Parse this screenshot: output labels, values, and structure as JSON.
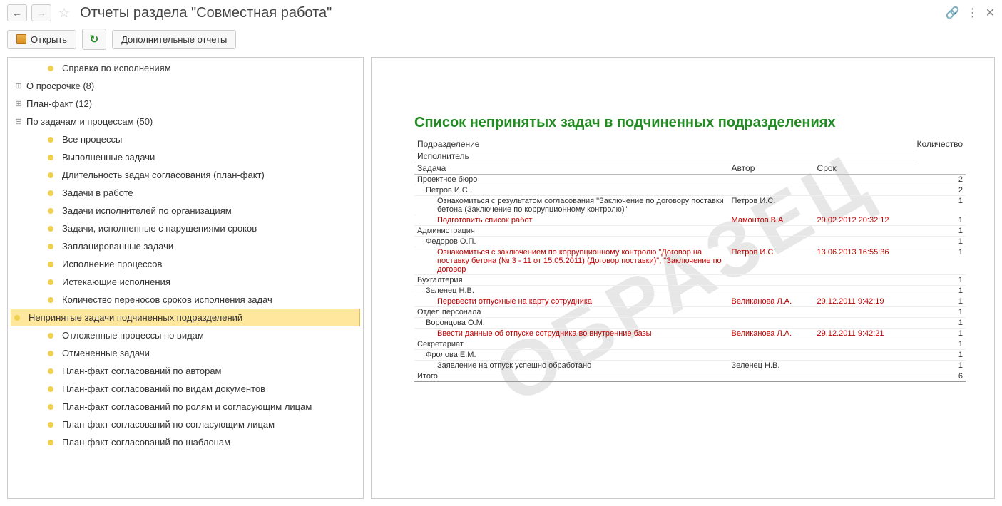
{
  "header": {
    "title": "Отчеты раздела \"Совместная работа\""
  },
  "toolbar": {
    "open_label": "Открыть",
    "additional_label": "Дополнительные отчеты"
  },
  "tree": {
    "items": [
      {
        "label": "Справка по исполнениям",
        "level": 1,
        "bullet": true
      },
      {
        "label": "О просрочке (8)",
        "level": 0,
        "toggle": "plus"
      },
      {
        "label": "План-факт (12)",
        "level": 0,
        "toggle": "plus"
      },
      {
        "label": "По задачам и процессам (50)",
        "level": 0,
        "toggle": "minus"
      },
      {
        "label": "Все процессы",
        "level": 1,
        "bullet": true
      },
      {
        "label": "Выполненные задачи",
        "level": 1,
        "bullet": true
      },
      {
        "label": "Длительность задач согласования (план-факт)",
        "level": 1,
        "bullet": true
      },
      {
        "label": "Задачи в работе",
        "level": 1,
        "bullet": true
      },
      {
        "label": "Задачи исполнителей  по организациям",
        "level": 1,
        "bullet": true
      },
      {
        "label": "Задачи, исполненные с нарушениями сроков",
        "level": 1,
        "bullet": true
      },
      {
        "label": "Запланированные задачи",
        "level": 1,
        "bullet": true
      },
      {
        "label": "Исполнение процессов",
        "level": 1,
        "bullet": true
      },
      {
        "label": "Истекающие исполнения",
        "level": 1,
        "bullet": true
      },
      {
        "label": "Количество переносов сроков исполнения задач",
        "level": 1,
        "bullet": true
      },
      {
        "label": "Непринятые задачи подчиненных подразделений",
        "level": 1,
        "bullet": true,
        "selected": true
      },
      {
        "label": "Отложенные процессы по видам",
        "level": 1,
        "bullet": true
      },
      {
        "label": "Отмененные задачи",
        "level": 1,
        "bullet": true
      },
      {
        "label": "План-факт согласований по авторам",
        "level": 1,
        "bullet": true
      },
      {
        "label": "План-факт согласований по видам документов",
        "level": 1,
        "bullet": true
      },
      {
        "label": "План-факт согласований по ролям и согласующим лицам",
        "level": 1,
        "bullet": true
      },
      {
        "label": "План-факт согласований по согласующим лицам",
        "level": 1,
        "bullet": true
      },
      {
        "label": "План-факт согласований по шаблонам",
        "level": 1,
        "bullet": true
      }
    ]
  },
  "report": {
    "watermark": "ОБРАЗЕЦ",
    "title": "Список непринятых задач в подчиненных подразделениях",
    "headers": {
      "department": "Подразделение",
      "executor": "Исполнитель",
      "task": "Задача",
      "author": "Автор",
      "deadline": "Срок",
      "count": "Количество"
    },
    "rows": [
      {
        "type": "dept",
        "text": "Проектное бюро",
        "count": "2"
      },
      {
        "type": "executor",
        "text": "Петров И.С.",
        "count": "2"
      },
      {
        "type": "task",
        "text": "Ознакомиться с результатом согласования \"Заключение по договору поставки бетона (Заключение по коррупционному контролю)\"",
        "author": "Петров И.С.",
        "count": "1"
      },
      {
        "type": "task",
        "red": true,
        "text": "Подготовить список работ",
        "author": "Мамонтов В.А.",
        "deadline": "29.02.2012 20:32:12",
        "count": "1"
      },
      {
        "type": "dept",
        "text": "Администрация",
        "count": "1"
      },
      {
        "type": "executor",
        "text": "Федоров О.П.",
        "count": "1"
      },
      {
        "type": "task",
        "red": true,
        "text": "Ознакомиться с заключением по коррупционному контролю \"Договор на поставку бетона (№ 3 - 11 от 15.05.2011) (Договор поставки)\", \"Заключение по договор",
        "author": "Петров И.С.",
        "deadline": "13.06.2013 16:55:36",
        "count": "1"
      },
      {
        "type": "dept",
        "text": "Бухгалтерия",
        "count": "1"
      },
      {
        "type": "executor",
        "text": "Зеленец Н.В.",
        "count": "1"
      },
      {
        "type": "task",
        "red": true,
        "text": "Перевести отпускные на карту сотрудника",
        "author": "Великанова Л.А.",
        "deadline": "29.12.2011 9:42:19",
        "count": "1"
      },
      {
        "type": "dept",
        "text": "Отдел персонала",
        "count": "1"
      },
      {
        "type": "executor",
        "text": "Воронцова О.М.",
        "count": "1"
      },
      {
        "type": "task",
        "red": true,
        "text": "Ввести данные об отпуске сотрудника во внутренние базы",
        "author": "Великанова Л.А.",
        "deadline": "29.12.2011 9:42:21",
        "count": "1"
      },
      {
        "type": "dept",
        "text": "Секретариат",
        "count": "1"
      },
      {
        "type": "executor",
        "text": "Фролова Е.М.",
        "count": "1"
      },
      {
        "type": "task",
        "text": "Заявление на отпуск успешно обработано",
        "author": "Зеленец Н.В.",
        "count": "1"
      }
    ],
    "total": {
      "label": "Итого",
      "count": "6"
    }
  }
}
